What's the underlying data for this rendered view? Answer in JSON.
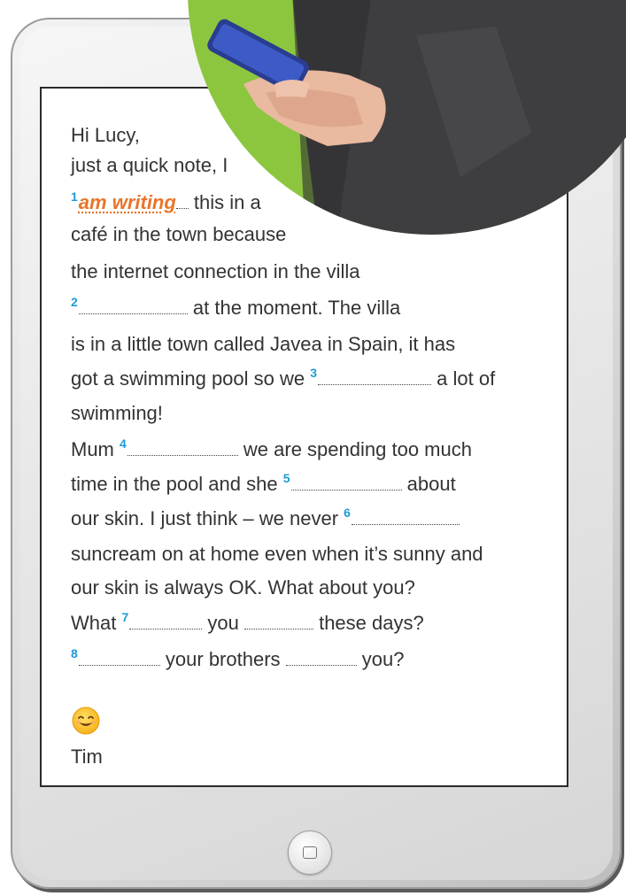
{
  "colors": {
    "number": "#1f9bd6",
    "answer": "#e8752a",
    "photo_circle": "#8cc63f"
  },
  "letter": {
    "greeting": "Hi Lucy,",
    "l2": "just a quick note, I",
    "n1": "1",
    "a1": "am writing",
    "l3b": " this in a",
    "l4": "café in the town because",
    "l5": "the internet connection in the villa",
    "n2": "2",
    "l6b": " at the moment. The villa",
    "l7": "is in a little town called Javea in Spain, it has",
    "l8a": "got a swimming pool so we ",
    "n3": "3",
    "l8b": " a lot of",
    "l9": "swimming!",
    "l10a": "Mum ",
    "n4": "4",
    "l10b": " we are spending too much",
    "l11a": "time in the pool and she ",
    "n5": "5",
    "l11b": " about",
    "l12a": "our skin. I just think – we never ",
    "n6": "6",
    "l13": "suncream on at home even when it’s sunny and",
    "l14": "our skin is always OK. What about you?",
    "l15a": "What ",
    "n7": "7",
    "l15b": " you ",
    "l15c": " these days?",
    "n8": "8",
    "l16b": " your brothers ",
    "l16c": " you?",
    "emoji": "smiley-emoji",
    "signature": "Tim"
  }
}
